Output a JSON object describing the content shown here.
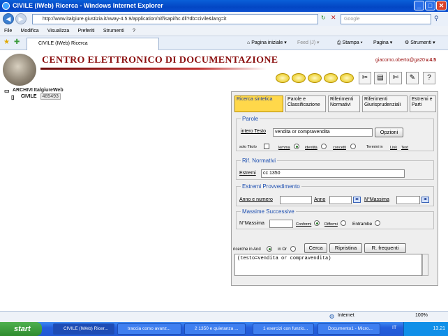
{
  "window": {
    "title": "CIVILE (IWeb) Ricerca - Windows Internet Explorer"
  },
  "browser": {
    "url": "http://www.italgiure.giustizia.it/xway-4.5.9/application/nif/isapi/hc.dll?db=civile&lang=it",
    "search_placeholder": "Google",
    "menu": [
      "File",
      "Modifica",
      "Visualizza",
      "Preferiti",
      "Strumenti",
      "?"
    ],
    "tab_label": "CIVILE (IWeb) Ricerca",
    "commands": {
      "home": "Pagina iniziale",
      "feed": "Feed (J)",
      "print": "Stampa",
      "page": "Pagina",
      "tools": "Strumenti"
    }
  },
  "header": {
    "title": "CENTRO ELETTRONICO DI DOCUMENTAZIONE",
    "user": "giacomo.oberto@ga20",
    "version": "v.4.5"
  },
  "tree": {
    "root": "ARCHIVI ItalgiureWeb",
    "child": "CIVILE",
    "count": "485493"
  },
  "form": {
    "tabs": [
      "Ricerca sintetica",
      "Parole e Classificazione",
      "Riferimenti Normativi",
      "Riferimenti Giurisprudenziali",
      "Estremi e Parti"
    ],
    "parole": {
      "legend": "Parole",
      "label": "intero Testo",
      "value": "vendita or compravendita",
      "options_button": "Opzioni",
      "solo_titolo": "solo Titolo",
      "lemma": "lemma",
      "identita": "identità",
      "concetti": "concetti",
      "termini": "Termini in",
      "link": "Link",
      "text": "Text"
    },
    "rif": {
      "legend": "Rif. Normativi",
      "label": "Estremi",
      "value": "cc 1350"
    },
    "estremi": {
      "legend": "Estremi Provvedimento",
      "anno_numero": "Anno e numero",
      "anno": "Anno",
      "nmassima": "N°Massima"
    },
    "massime": {
      "legend": "Massime Successive",
      "nmassima": "N°Massima",
      "conformi": "Conformi",
      "difformi": "Difformi",
      "entrambe": "Entrambe"
    },
    "and_label": "ricerche in And",
    "or_label": "in Or",
    "buttons": {
      "cerca": "Cerca",
      "ripristina": "Ripristina",
      "frequenti": "R. frequenti"
    },
    "query": "(testo=vendita or compravendita)"
  },
  "status": {
    "zone": "Internet",
    "zoom": "100%"
  },
  "taskbar": {
    "start": "start",
    "items": [
      "CIVILE (IWeb) Ricer...",
      "traccia corso avanz...",
      "2 1350 e quietanza ...",
      "1 esercizi con funzio...",
      "Documento1 - Micro..."
    ],
    "lang": "IT",
    "time": "13.21"
  }
}
